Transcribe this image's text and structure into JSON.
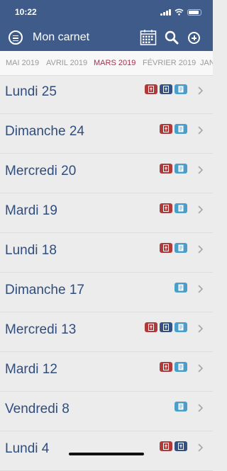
{
  "status_bar": {
    "time": "10:22"
  },
  "header": {
    "title": "Mon carnet"
  },
  "month_tabs": [
    {
      "label": "MAI 2019",
      "active": false
    },
    {
      "label": "AVRIL 2019",
      "active": false
    },
    {
      "label": "MARS 2019",
      "active": true
    },
    {
      "label": "FÉVRIER 2019",
      "active": false
    },
    {
      "label": "JANV",
      "active": false
    }
  ],
  "entries": [
    {
      "label": "Lundi 25",
      "badges": [
        "red-document-icon",
        "navy-document-icon",
        "teal-note-icon"
      ]
    },
    {
      "label": "Dimanche 24",
      "badges": [
        "red-document-icon",
        "teal-note-icon"
      ]
    },
    {
      "label": "Mercredi 20",
      "badges": [
        "red-document-icon",
        "teal-note-icon"
      ]
    },
    {
      "label": "Mardi 19",
      "badges": [
        "red-document-icon",
        "teal-note-icon"
      ]
    },
    {
      "label": "Lundi 18",
      "badges": [
        "red-document-icon",
        "teal-note-icon"
      ]
    },
    {
      "label": "Dimanche 17",
      "badges": [
        "teal-note-icon"
      ]
    },
    {
      "label": "Mercredi 13",
      "badges": [
        "red-document-icon",
        "navy-document-icon",
        "teal-note-icon"
      ]
    },
    {
      "label": "Mardi 12",
      "badges": [
        "red-document-icon",
        "teal-note-icon"
      ]
    },
    {
      "label": "Vendredi 8",
      "badges": [
        "teal-note-icon"
      ]
    },
    {
      "label": "Lundi 4",
      "badges": [
        "red-document-icon",
        "navy-document-icon"
      ]
    }
  ],
  "colors": {
    "header_bg": "#3f5b8a",
    "active_tab": "#b02a4e",
    "entry_text": "#2f4d7e",
    "badge_red": "#b03a3a",
    "badge_navy": "#345180",
    "badge_teal": "#4a9ec9"
  }
}
